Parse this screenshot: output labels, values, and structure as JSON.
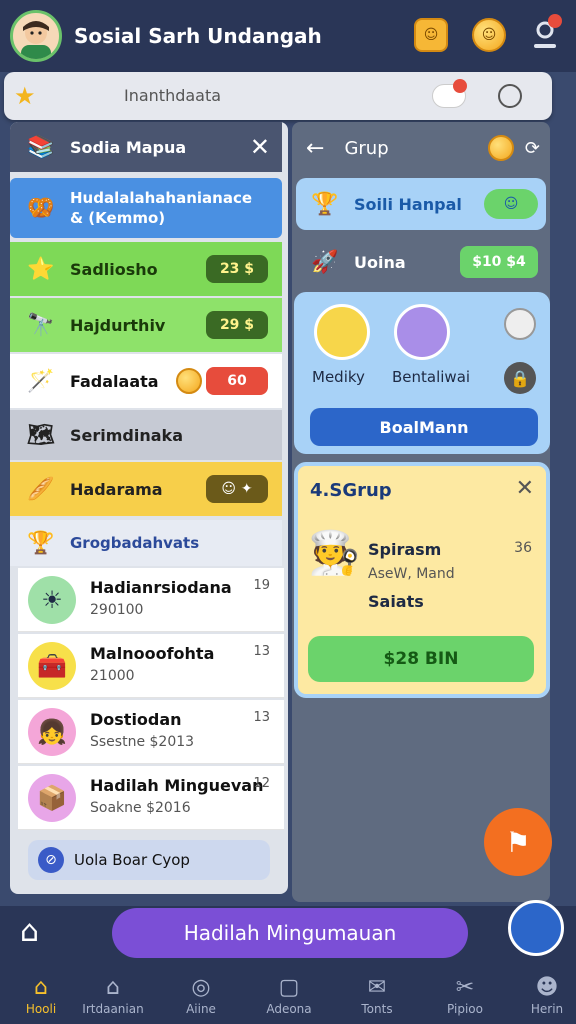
{
  "header": {
    "title": "Sosial Sarh Undangah",
    "coin1": "☺",
    "coin2": "☺",
    "profile_icon": "user-icon"
  },
  "search": {
    "placeholder": "Inanthdaata"
  },
  "left": {
    "header": "Sodia Mapua",
    "rows": [
      {
        "label": "Hudalalahahanianace & (Kemmo)"
      },
      {
        "label": "Sadliosho",
        "value": "23 $"
      },
      {
        "label": "Hajdurthiv",
        "value": "29 $"
      },
      {
        "label": "Fadalaata",
        "value": "60"
      },
      {
        "label": "Serimdinaka"
      },
      {
        "label": "Hadarama"
      }
    ],
    "section": "Grogbadahvats",
    "list": [
      {
        "title": "Hadianrsiodana",
        "sub": "290100",
        "num": "19"
      },
      {
        "title": "Malnooofohta",
        "sub": "21000",
        "num": "13"
      },
      {
        "title": "Dostiodan",
        "sub": "Ssestne $2013",
        "num": "13"
      },
      {
        "title": "Hadilah Minguevan",
        "sub": "Soakne $2016",
        "num": "12"
      }
    ],
    "footer_button": "Uola Boar Cyop"
  },
  "right": {
    "header": "Grup",
    "row1": "Soili Hanpal",
    "row2": "Uoina",
    "row2_value": "$10 $4",
    "card": {
      "user1": "Mediky",
      "user2": "Bentaliwai",
      "button": "BoalMann"
    },
    "group": {
      "title": "4.SGrup",
      "name": "Spirasm",
      "num": "36",
      "sub": "AseW, Mand",
      "sub2": "Saiats",
      "button": "$28 BIN"
    }
  },
  "cta": {
    "label": "Hadilah Mingumauan"
  },
  "nav": [
    {
      "label": "Hooli"
    },
    {
      "label": "Irtdaanian"
    },
    {
      "label": "Aiine"
    },
    {
      "label": "Adeona"
    },
    {
      "label": "Tonts"
    },
    {
      "label": "Pipioo"
    },
    {
      "label": "Herin"
    }
  ],
  "colors": {
    "accent": "#7b4fd6",
    "green": "#7ed957",
    "yellow": "#f7cf4a",
    "blue": "#4a90e2"
  }
}
